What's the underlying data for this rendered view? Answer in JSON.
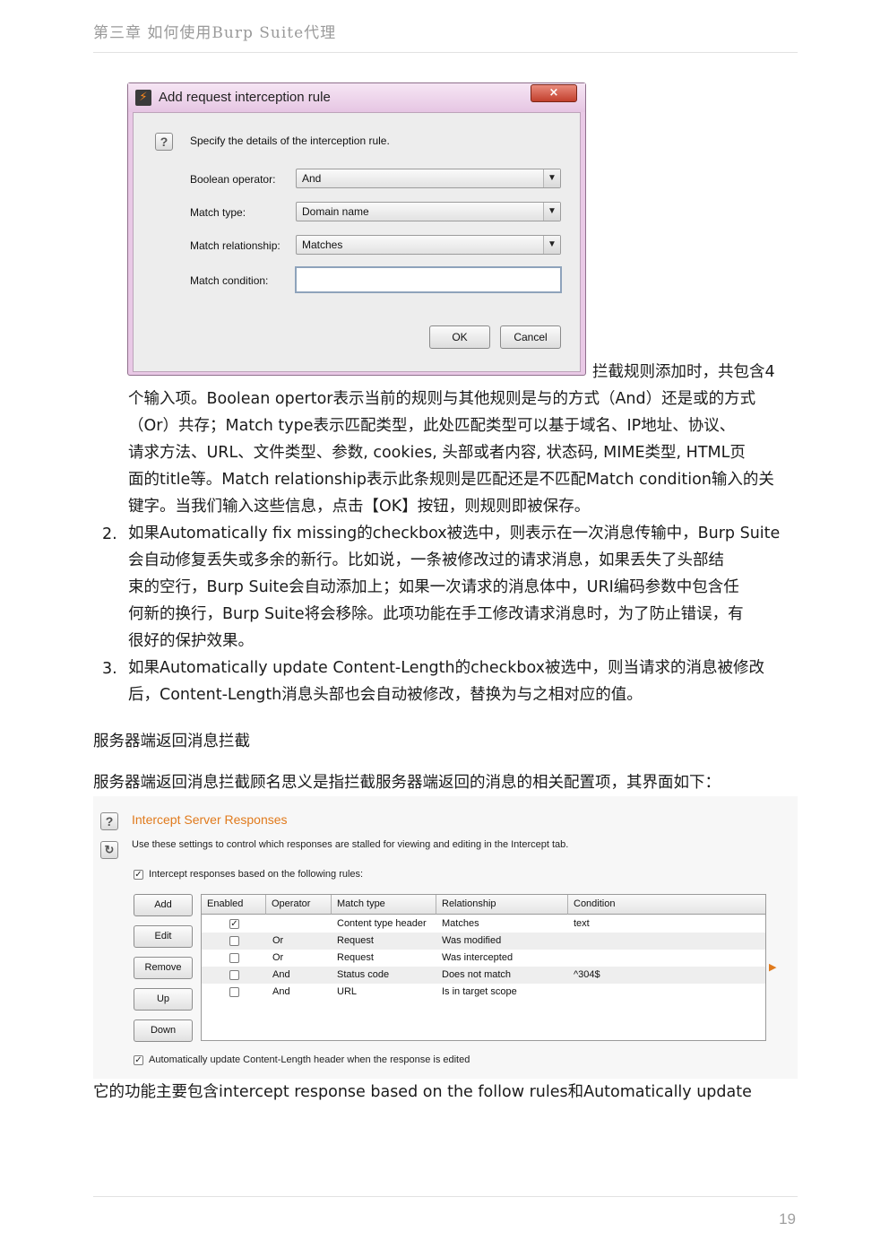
{
  "header": {
    "chapter_title": "第三章 如何使用Burp Suite代理"
  },
  "dialog": {
    "title": "Add request interception rule",
    "close_icon": "×",
    "prompt": "Specify the details of the interception rule.",
    "fields": [
      {
        "label": "Boolean operator:",
        "value": "And"
      },
      {
        "label": "Match type:",
        "value": "Domain name"
      },
      {
        "label": "Match relationship:",
        "value": "Matches"
      }
    ],
    "condition_label": "Match condition:",
    "condition_value": "",
    "ok_label": "OK",
    "cancel_label": "Cancel"
  },
  "body": {
    "para1": [
      "拦截规则添加时，共包含4",
      "个输入项。Boolean opertor表示当前的规则与其他规则是与的方式（And）还是或的方式",
      "（Or）共存；Match type表示匹配类型，此处匹配类型可以基于域名、IP地址、协议、",
      "请求方法、URL、文件类型、参数, cookies, 头部或者内容, 状态码, MIME类型, HTML页",
      "面的title等。Match relationship表示此条规则是匹配还是不匹配Match condition输入的关",
      "键字。当我们输入这些信息，点击【OK】按钮，则规则即被保存。"
    ],
    "item2_number": "2.",
    "item2": [
      "如果Automatically fix missing的checkbox被选中，则表示在一次消息传输中，Burp Suite",
      "会自动修复丢失或多余的新行。比如说，一条被修改过的请求消息，如果丢失了头部结",
      "束的空行，Burp Suite会自动添加上；如果一次请求的消息体中，URI编码参数中包含任",
      "何新的换行，Burp Suite将会移除。此项功能在手工修改请求消息时，为了防止错误，有",
      "很好的保护效果。"
    ],
    "item3_number": "3.",
    "item3": [
      "如果Automatically update Content-Length的checkbox被选中，则当请求的消息被修改",
      "后，Content-Length消息头部也会自动被修改，替换为与之相对应的值。"
    ],
    "section_heading": "服务器端返回消息拦截",
    "section_intro": "服务器端返回消息拦截顾名思义是指拦截服务器端返回的消息的相关配置项，其界面如下：",
    "closing": "它的功能主要包含intercept response based on the follow rules和Automatically update"
  },
  "panel": {
    "title": "Intercept Server Responses",
    "help_icon": "?",
    "refresh_icon": "↻",
    "description": "Use these settings to control which responses are stalled for viewing and editing in the Intercept tab.",
    "intercept_checkbox_label": "Intercept responses based on the following rules:",
    "intercept_checked": true,
    "buttons": [
      "Add",
      "Edit",
      "Remove",
      "Up",
      "Down"
    ],
    "columns": [
      "Enabled",
      "Operator",
      "Match type",
      "Relationship",
      "Condition"
    ],
    "rows": [
      {
        "enabled": true,
        "operator": "",
        "match_type": "Content type header",
        "relationship": "Matches",
        "condition": "text"
      },
      {
        "enabled": false,
        "operator": "Or",
        "match_type": "Request",
        "relationship": "Was modified",
        "condition": ""
      },
      {
        "enabled": false,
        "operator": "Or",
        "match_type": "Request",
        "relationship": "Was intercepted",
        "condition": ""
      },
      {
        "enabled": false,
        "operator": "And",
        "match_type": "Status code",
        "relationship": "Does not match",
        "condition": "^304$"
      },
      {
        "enabled": false,
        "operator": "And",
        "match_type": "URL",
        "relationship": "Is in target scope",
        "condition": ""
      }
    ],
    "update_checkbox_label": "Automatically update Content-Length header when the response is edited",
    "update_checked": true,
    "accent_color": "#e07a1c"
  },
  "footer": {
    "page_number": "19"
  }
}
